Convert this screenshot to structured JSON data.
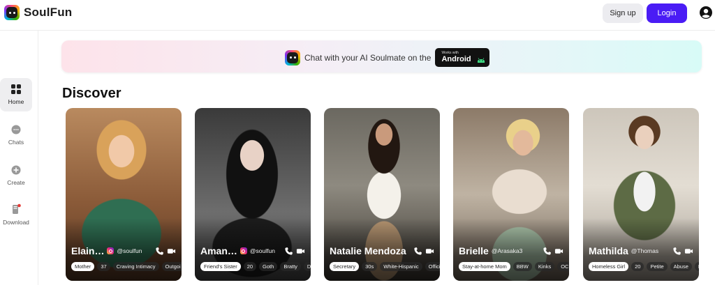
{
  "brand": {
    "name": "SoulFun"
  },
  "header": {
    "signup_label": "Sign up",
    "login_label": "Login",
    "login_color": "#4a1cf5"
  },
  "sidebar": {
    "items": [
      {
        "label": "Home",
        "icon": "grid-icon",
        "active": true
      },
      {
        "label": "Chats",
        "icon": "chat-icon",
        "active": false
      },
      {
        "label": "Create",
        "icon": "plus-circle-icon",
        "active": false
      },
      {
        "label": "Download",
        "icon": "download-phone-icon",
        "active": false,
        "badge": true
      }
    ]
  },
  "banner": {
    "text": "Chat with your AI Soulmate on the",
    "badge_small": "Works with",
    "badge_big": "Android"
  },
  "discover": {
    "title": "Discover",
    "cards": [
      {
        "name": "Elain…",
        "handle": "@soulfun",
        "instagram": true,
        "tags": [
          "Mother",
          "37",
          "Craving Intimacy",
          "Outgoi"
        ]
      },
      {
        "name": "Aman…",
        "handle": "@soulfun",
        "instagram": true,
        "tags": [
          "Friend's Sister",
          "20",
          "Goth",
          "Bratty",
          "De"
        ]
      },
      {
        "name": "Natalie Mendoza",
        "handle": "",
        "instagram": false,
        "tags": [
          "Secretary",
          "30s",
          "White-Hispanic",
          "Offici"
        ]
      },
      {
        "name": "Brielle",
        "handle": "@Arasaka3",
        "instagram": false,
        "tags": [
          "Stay-at-home Mom",
          "BBW",
          "Kinks",
          "OC"
        ]
      },
      {
        "name": "Mathilda",
        "handle": "@Thomas",
        "instagram": false,
        "tags": [
          "Homeless Girl",
          "20",
          "Petite",
          "Abuse",
          "P"
        ]
      }
    ]
  }
}
